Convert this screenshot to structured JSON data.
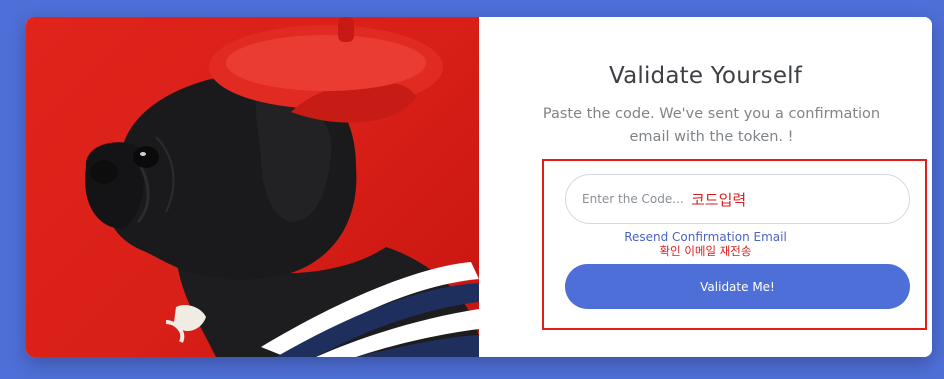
{
  "form": {
    "title": "Validate Yourself",
    "subtitle": "Paste the code. We've sent you a confirmation email with the token. !",
    "code_placeholder": "Enter the Code...",
    "code_annotation": "코드입력",
    "resend_label": "Resend Confirmation Email",
    "resend_annotation": "확인 이메일 재전송",
    "submit_label": "Validate Me!"
  },
  "image": {
    "subject": "pug-in-red-beret"
  },
  "colors": {
    "background": "#4e6fd8",
    "accent": "#4e6fd8",
    "annotation": "#e41b1b",
    "photo_background": "#e0241c"
  }
}
